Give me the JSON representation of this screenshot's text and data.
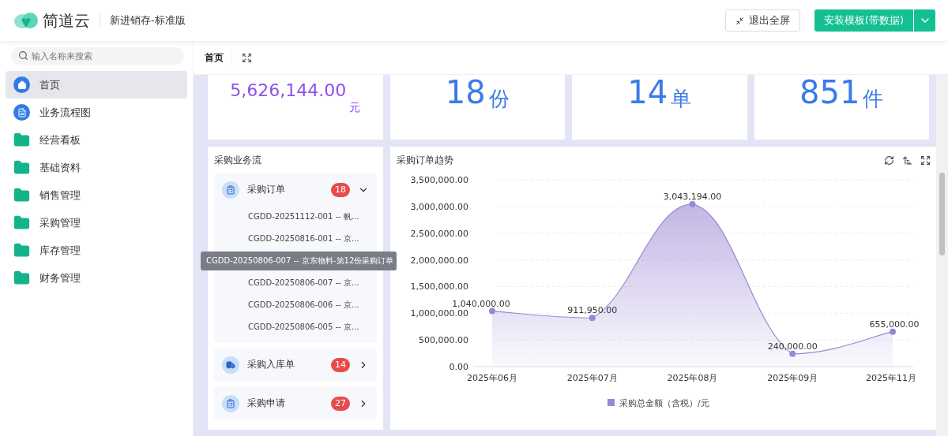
{
  "header": {
    "brand": "简道云",
    "app_title": "新进销存-标准版",
    "exit_button": "退出全屏",
    "install_button": "安装模板(带数据)"
  },
  "sidebar": {
    "search": {
      "placeholder": "输入名称来搜索"
    },
    "items": [
      {
        "label": "首页",
        "kind": "home",
        "selected": true
      },
      {
        "label": "业务流程图",
        "kind": "doc",
        "selected": false
      },
      {
        "label": "经营看板",
        "kind": "folder",
        "selected": false
      },
      {
        "label": "基础资料",
        "kind": "folder",
        "selected": false
      },
      {
        "label": "销售管理",
        "kind": "folder",
        "selected": false
      },
      {
        "label": "采购管理",
        "kind": "folder",
        "selected": false
      },
      {
        "label": "库存管理",
        "kind": "folder",
        "selected": false
      },
      {
        "label": "财务管理",
        "kind": "folder",
        "selected": false
      }
    ]
  },
  "tabs": [
    {
      "label": "首页",
      "selected": true
    }
  ],
  "stats": [
    {
      "value": "5,626,144.00",
      "unit": "元",
      "color": "#8e4ef0"
    },
    {
      "value": "18",
      "unit": "份",
      "color": "#3a7be8"
    },
    {
      "value": "14",
      "unit": "单",
      "color": "#3a7be8"
    },
    {
      "value": "851",
      "unit": "件",
      "color": "#3a7be8"
    }
  ],
  "flow": {
    "title": "采购业务流",
    "groups": [
      {
        "label": "采购订单",
        "count": "18",
        "kind": "clipboard",
        "expanded": true,
        "items": [
          "CGDD-20251112-001 -- 帆...",
          "CGDD-20250816-001 -- 京...",
          "CGDD-20250806-007 -- 京...",
          "CGDD-20250806-006 -- 京...",
          "CGDD-20250806-005 -- 京..."
        ],
        "tooltip": {
          "text": "CGDD-20250806-007 -- 京东物料-第12份采购订单"
        }
      },
      {
        "label": "采购入库单",
        "count": "14",
        "kind": "truck",
        "expanded": false
      },
      {
        "label": "采购申请",
        "count": "27",
        "kind": "clipboard",
        "expanded": false
      }
    ]
  },
  "trend": {
    "title": "采购订单趋势",
    "chart_data": {
      "type": "area",
      "categories": [
        "2025年06月",
        "2025年07月",
        "2025年08月",
        "2025年09月",
        "2025年11月"
      ],
      "series": [
        {
          "name": "采购总金额（含税）/元",
          "color": "#9b86d4",
          "values": [
            1040000,
            911950,
            3043194,
            240000,
            655000
          ]
        }
      ],
      "ylim": [
        0,
        3500000
      ],
      "grid": true,
      "yticks": [
        {
          "value": 0,
          "label": "0.00"
        },
        {
          "value": 500000,
          "label": "500,000.00"
        },
        {
          "value": 1000000,
          "label": "1,000,000.00"
        },
        {
          "value": 1500000,
          "label": "1,500,000.00"
        },
        {
          "value": 2000000,
          "label": "2,000,000.00"
        },
        {
          "value": 2500000,
          "label": "2,500,000.00"
        },
        {
          "value": 3000000,
          "label": "3,000,000.00"
        },
        {
          "value": 3500000,
          "label": "3,500,000.00"
        }
      ],
      "value_labels": [
        "1,040,000.00",
        "911,950.00",
        "3,043,194.00",
        "240,000.00",
        "655,000.00"
      ]
    }
  }
}
